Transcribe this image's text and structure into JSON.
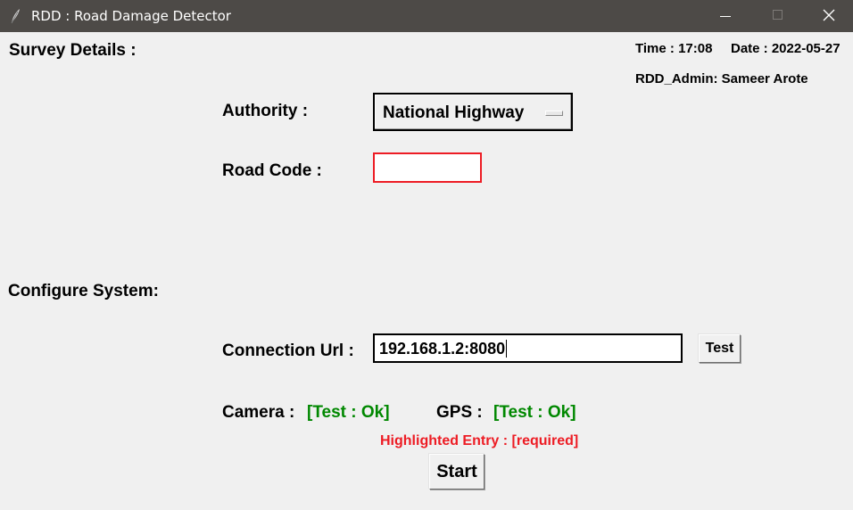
{
  "window": {
    "title": "RDD : Road Damage Detector",
    "icon": "feather-icon",
    "controls": [
      "minimize-icon",
      "maximize-icon",
      "close-icon"
    ]
  },
  "header": {
    "time": "Time : 17:08",
    "date": "Date : 2022-05-27",
    "user": "RDD_Admin: Sameer Arote"
  },
  "survey": {
    "title": "Survey Details :",
    "authority_label": "Authority :",
    "authority_value": "National Highway",
    "road_code_label": "Road Code :",
    "road_code_value": ""
  },
  "config": {
    "title": "Configure System:",
    "connection_label": "Connection Url :",
    "connection_value": "192.168.1.2:8080",
    "test_button": "Test",
    "camera_label": "Camera :",
    "camera_status": "[Test : Ok]",
    "gps_label": "GPS :",
    "gps_status": "[Test : Ok]"
  },
  "footer": {
    "required_note": "Highlighted Entry : [required]",
    "start_button": "Start"
  },
  "colors": {
    "titlebar": "#4d4a47",
    "background": "#f0f0f0",
    "ok": "#008800",
    "required": "#ed1c24"
  }
}
